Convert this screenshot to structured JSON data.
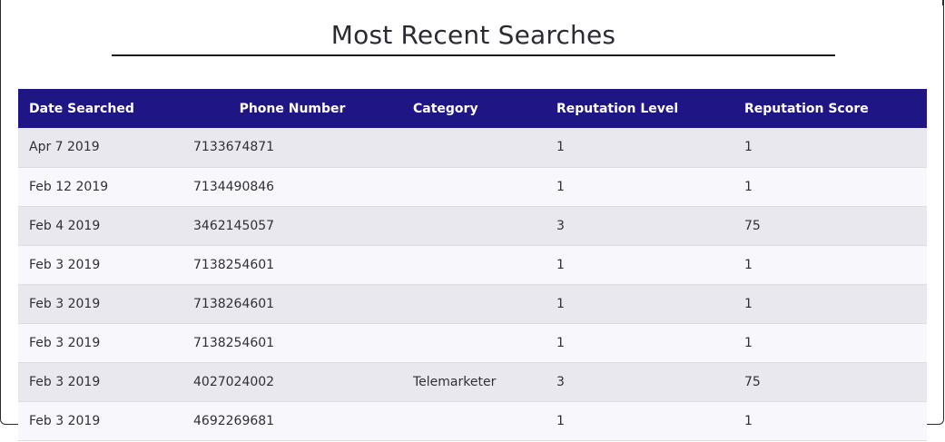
{
  "page": {
    "title": "Most Recent Searches"
  },
  "table": {
    "headers": [
      "Date Searched",
      "Phone Number",
      "Category",
      "Reputation Level",
      "Reputation Score"
    ],
    "rows": [
      [
        "Apr 7 2019",
        "7133674871",
        "",
        "1",
        "1"
      ],
      [
        "Feb 12 2019",
        "7134490846",
        "",
        "1",
        "1"
      ],
      [
        "Feb 4 2019",
        "3462145057",
        "",
        "3",
        "75"
      ],
      [
        "Feb 3 2019",
        "7138254601",
        "",
        "1",
        "1"
      ],
      [
        "Feb 3 2019",
        "7138264601",
        "",
        "1",
        "1"
      ],
      [
        "Feb 3 2019",
        "7138254601",
        "",
        "1",
        "1"
      ],
      [
        "Feb 3 2019",
        "4027024002",
        "Telemarketer",
        "3",
        "75"
      ],
      [
        "Feb 3 2019",
        "4692269681",
        "",
        "1",
        "1"
      ]
    ]
  },
  "colors": {
    "header_bg": "#201585",
    "row_odd": "#e8e8ee",
    "row_even": "#f7f7fc"
  }
}
